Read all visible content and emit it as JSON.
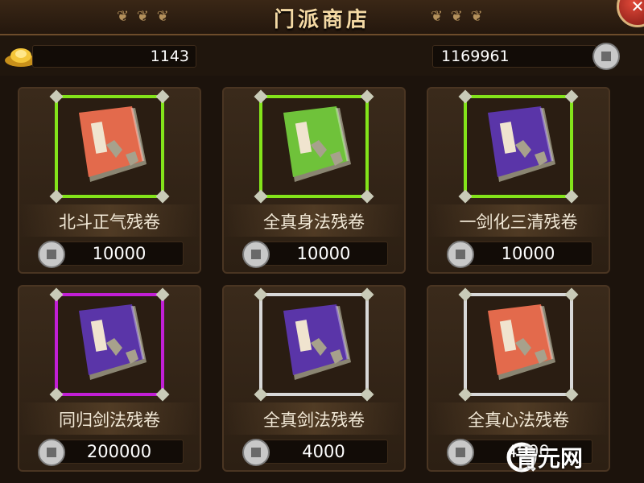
{
  "header": {
    "title": "门派商店",
    "close_symbol": "✕"
  },
  "currency": {
    "gold": "1143",
    "silver": "1169961"
  },
  "items": [
    {
      "name": "北斗正气残卷",
      "price": "10000",
      "frame_color": "#83e41a",
      "book_color": "#e36a4c"
    },
    {
      "name": "全真身法残卷",
      "price": "10000",
      "frame_color": "#83e41a",
      "book_color": "#6fc23a"
    },
    {
      "name": "一剑化三清残卷",
      "price": "10000",
      "frame_color": "#83e41a",
      "book_color": "#5a35a8"
    },
    {
      "name": "同归剑法残卷",
      "price": "200000",
      "frame_color": "#c21fd6",
      "book_color": "#5a35a8"
    },
    {
      "name": "全真剑法残卷",
      "price": "4000",
      "frame_color": "#d8d8d8",
      "book_color": "#5a35a8"
    },
    {
      "name": "全真心法残卷",
      "price": "4000",
      "frame_color": "#d8d8d8",
      "book_color": "#e36a4c"
    }
  ],
  "watermark": {
    "text": "青元网"
  }
}
